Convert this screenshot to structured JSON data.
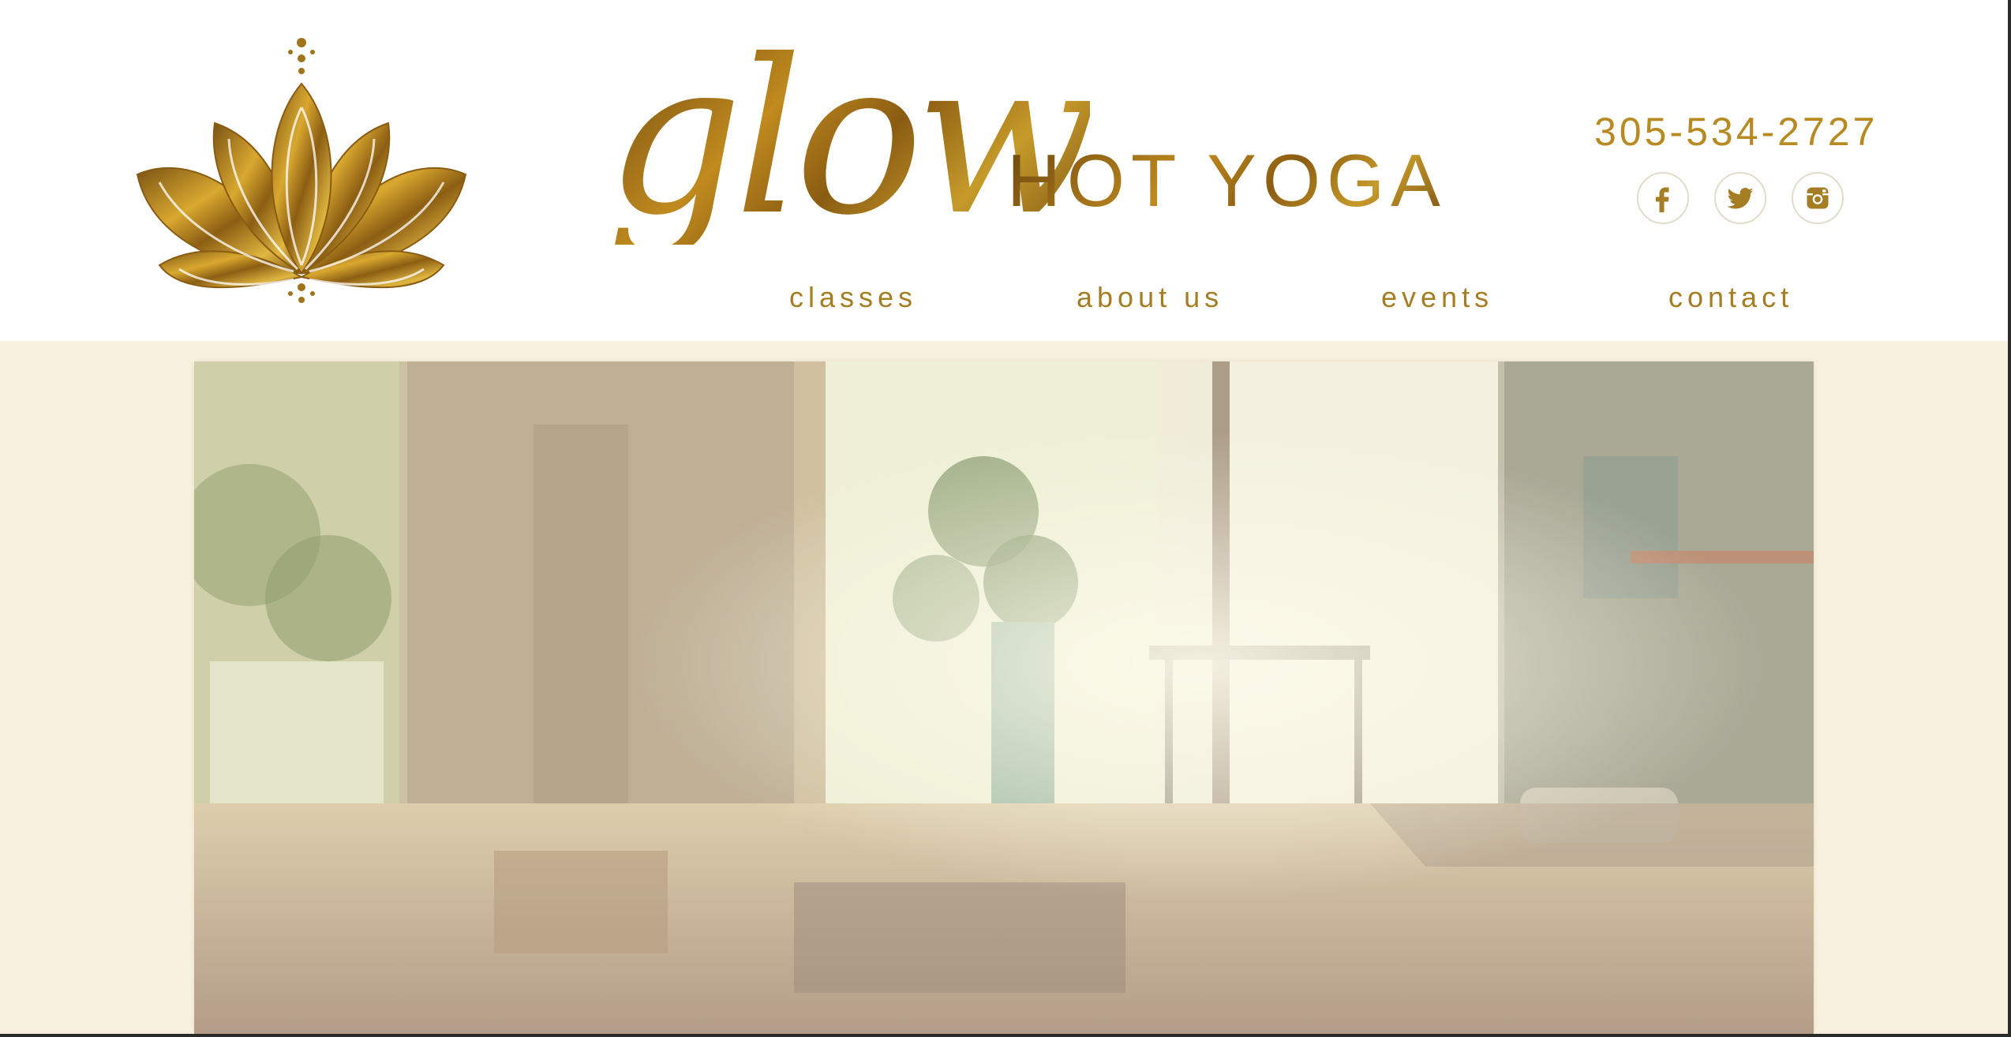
{
  "brand": {
    "script_name": "glow",
    "sub_name": "HOT YOGA",
    "logo_icon": "lotus-icon"
  },
  "contact": {
    "phone": "305-534-2727"
  },
  "social": [
    {
      "name": "facebook",
      "icon": "facebook-icon",
      "glyph": "f"
    },
    {
      "name": "twitter",
      "icon": "twitter-icon"
    },
    {
      "name": "instagram",
      "icon": "instagram-icon"
    }
  ],
  "nav": {
    "items": [
      {
        "label": "classes"
      },
      {
        "label": "about us"
      },
      {
        "label": "events"
      },
      {
        "label": "contact"
      }
    ]
  },
  "hero": {
    "description_icon": "studio-photo"
  },
  "colors": {
    "gold": "#a57d22",
    "gold_dark": "#7a5314",
    "cream": "#f7f0dc",
    "white": "#ffffff"
  }
}
